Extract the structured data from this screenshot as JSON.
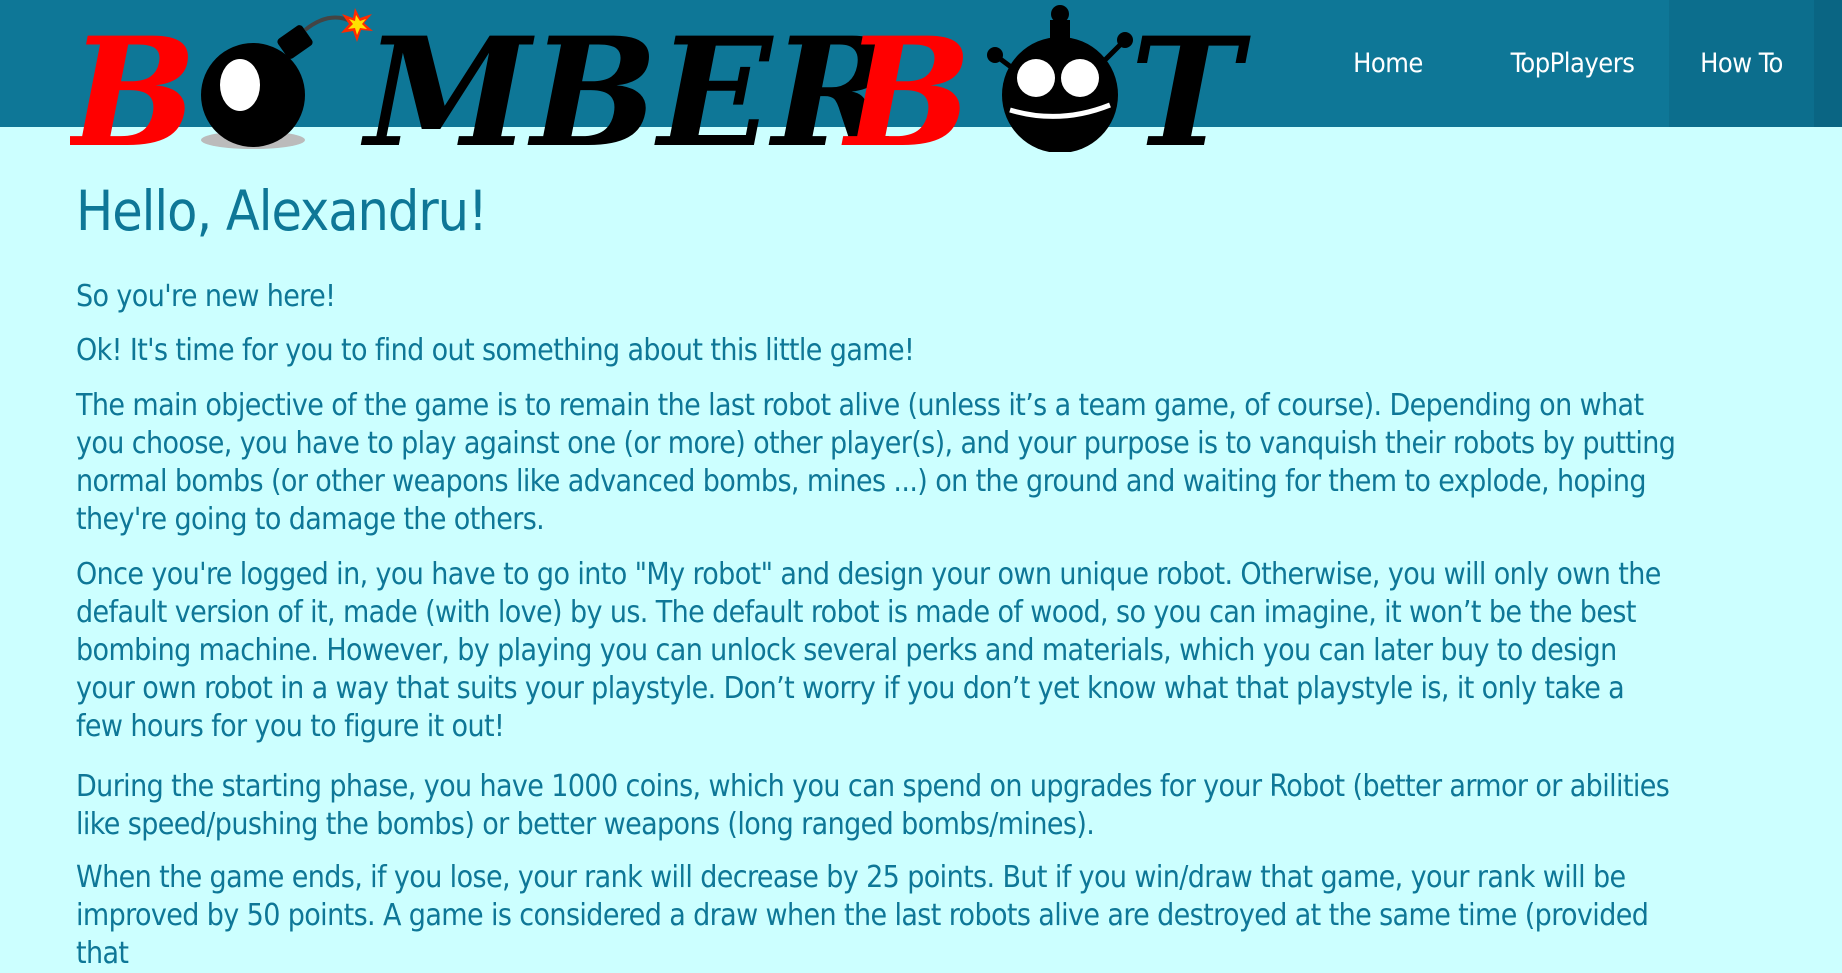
{
  "logo": {
    "text": "BOMBERBOT"
  },
  "nav": {
    "items": [
      {
        "label": "Home"
      },
      {
        "label": "TopPlayers"
      },
      {
        "label": "How To"
      }
    ]
  },
  "main": {
    "title": "Hello, Alexandru!",
    "paragraphs": [
      "So you're new here!",
      "Ok! It's time for you to find out something about this little game!",
      "The main objective of the game is to remain the last robot alive (unless it’s a team game, of course). Depending on what you choose, you have to play against one (or more) other player(s), and your purpose is to vanquish their robots by putting normal bombs (or other weapons like advanced bombs, mines ...) on the ground and waiting for them to explode, hoping they're going to damage the others.",
      "Once you're logged in, you have to go into \"My robot\" and design your own unique robot. Otherwise, you will only own the default version of it, made (with love) by us. The default robot is made of wood, so you can imagine, it won’t be the best bombing machine. However, by playing you can unlock several perks and materials, which you can later buy to design your own robot in a way that suits your playstyle. Don’t worry if you don’t yet know what that playstyle is, it only take a few hours for you to figure it out!",
      "During the starting phase, you have 1000 coins, which you can spend on upgrades for your Robot (better armor or abilities like speed/pushing the bombs) or better weapons (long ranged bombs/mines).",
      "When the game ends, if you lose, your rank will decrease by 25 points. But if you win/draw that game, your rank will be improved by 50 points. A game is considered a draw when the last robots alive are destroyed at the same time (provided that"
    ]
  },
  "colors": {
    "background": "#ccffff",
    "header": "#0e7797",
    "text": "#0e7797",
    "logo_red": "#ff0000",
    "logo_black": "#000000"
  }
}
